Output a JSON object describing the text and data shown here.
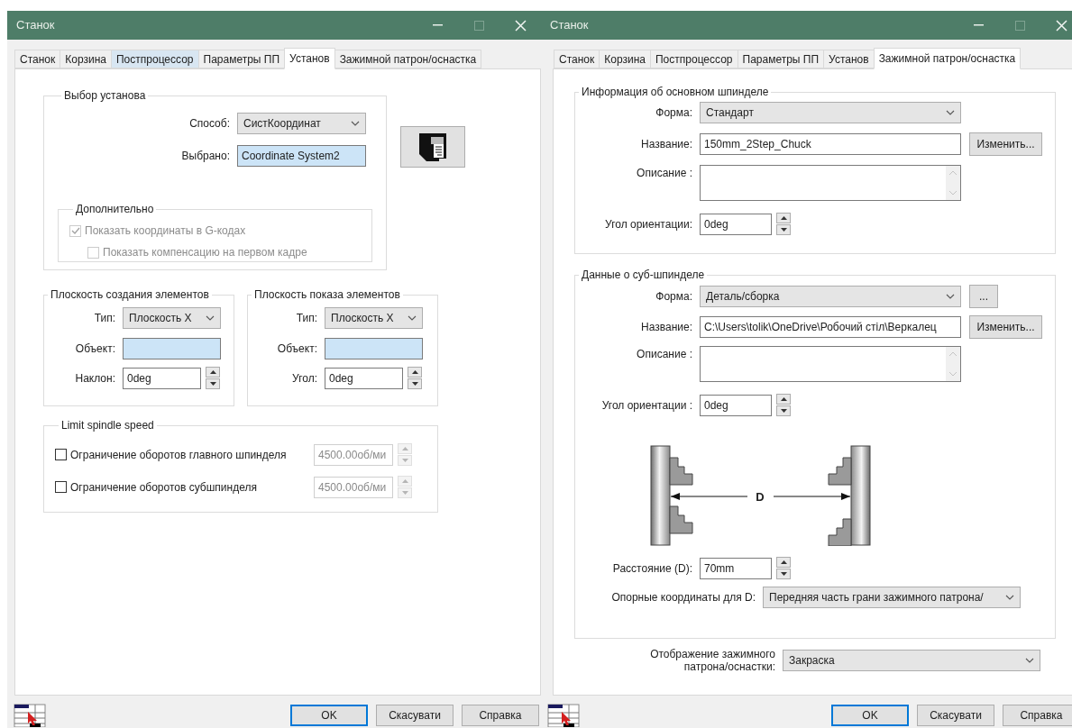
{
  "setup_window": {
    "title": "Станок",
    "tabs": [
      {
        "label": "Станок",
        "selected": false,
        "hovered": false
      },
      {
        "label": "Корзина",
        "selected": false,
        "hovered": false
      },
      {
        "label": "Постпроцессор",
        "selected": false,
        "hovered": true
      },
      {
        "label": "Параметры ПП",
        "selected": false,
        "hovered": false
      },
      {
        "label": "Установ",
        "selected": true,
        "hovered": false
      },
      {
        "label": "Зажимной патрон/оснастка",
        "selected": false,
        "hovered": false
      }
    ],
    "setup_selection": {
      "title": "Выбор установа",
      "method": {
        "label": "Способ:",
        "value": "СистКоординат"
      },
      "selection": {
        "label": "Выбрано:",
        "value": "Coordinate System2"
      },
      "extra": {
        "title": "Дополнительно",
        "options": [
          {
            "label": "Показать координаты в G-кодах",
            "checked": true,
            "disabled": true
          },
          {
            "label": "Показать компенсацию на первом кадре",
            "checked": false,
            "disabled": true
          }
        ]
      }
    },
    "planes": [
      {
        "title": "Плоскость создания элементов",
        "type": {
          "label": "Тип:",
          "value": "Плоскость X"
        },
        "object": {
          "label": "Объект:"
        },
        "angle": {
          "label": "Наклон:",
          "value": "0deg"
        }
      },
      {
        "title": "Плоскость показа элементов",
        "type": {
          "label": "Тип:",
          "value": "Плоскость X"
        },
        "object": {
          "label": "Объект:"
        },
        "angle": {
          "label": "Угол:",
          "value": "0deg"
        }
      }
    ],
    "spindle_limit": {
      "title": "Limit spindle speed",
      "rows": [
        {
          "label": "Ограничение оборотов главного шпинделя",
          "checked": false,
          "value": "4500.00об/ми"
        },
        {
          "label": "Ограничение оборотов субшпинделя",
          "checked": false,
          "value": "4500.00об/ми"
        }
      ]
    },
    "buttons": [
      {
        "label": "OK",
        "default": true
      },
      {
        "label": "Скасувати",
        "default": false
      },
      {
        "label": "Справка",
        "default": false
      }
    ]
  },
  "chuck_window": {
    "title": "Станок",
    "tabs": [
      {
        "label": "Станок",
        "selected": false,
        "hovered": false
      },
      {
        "label": "Корзина",
        "selected": false,
        "hovered": false
      },
      {
        "label": "Постпроцессор",
        "selected": false,
        "hovered": false
      },
      {
        "label": "Параметры ПП",
        "selected": false,
        "hovered": false
      },
      {
        "label": "Установ",
        "selected": false,
        "hovered": false
      },
      {
        "label": "Зажимной патрон/оснастка",
        "selected": true,
        "hovered": false
      }
    ],
    "main_spindle": {
      "title": "Информация об основном шпинделе",
      "form": {
        "label": "Форма:",
        "value": "Стандарт"
      },
      "name": {
        "label": "Название:",
        "value": "150mm_2Step_Chuck",
        "button": "Изменить..."
      },
      "description": {
        "label": "Описание :"
      },
      "orientation": {
        "label": "Угол ориентации:",
        "value": "0deg"
      }
    },
    "sub_spindle": {
      "title": "Данные о суб-шпинделе",
      "form": {
        "label": "Форма:",
        "value": "Деталь/сборка",
        "button": "..."
      },
      "name": {
        "label": "Название:",
        "value": "C:\\Users\\tolik\\OneDrive\\Робочий стіл\\Веркалец",
        "button": "Изменить..."
      },
      "description": {
        "label": "Описание :"
      },
      "orientation": {
        "label": "Угол ориентации :",
        "value": "0deg"
      },
      "diagram": {
        "distance_label": "D"
      },
      "distance": {
        "label": "Расстояние (D):",
        "value": "70mm"
      },
      "reference": {
        "label": "Опорные координаты для D:",
        "value": "Передняя часть грани зажимного патрона/"
      }
    },
    "display": {
      "label": "Отображение зажимного патрона/оснастки:",
      "value": "Закраска"
    },
    "buttons": [
      {
        "label": "OK",
        "default": true
      },
      {
        "label": "Скасувати",
        "default": false
      },
      {
        "label": "Справка",
        "default": false
      }
    ]
  }
}
